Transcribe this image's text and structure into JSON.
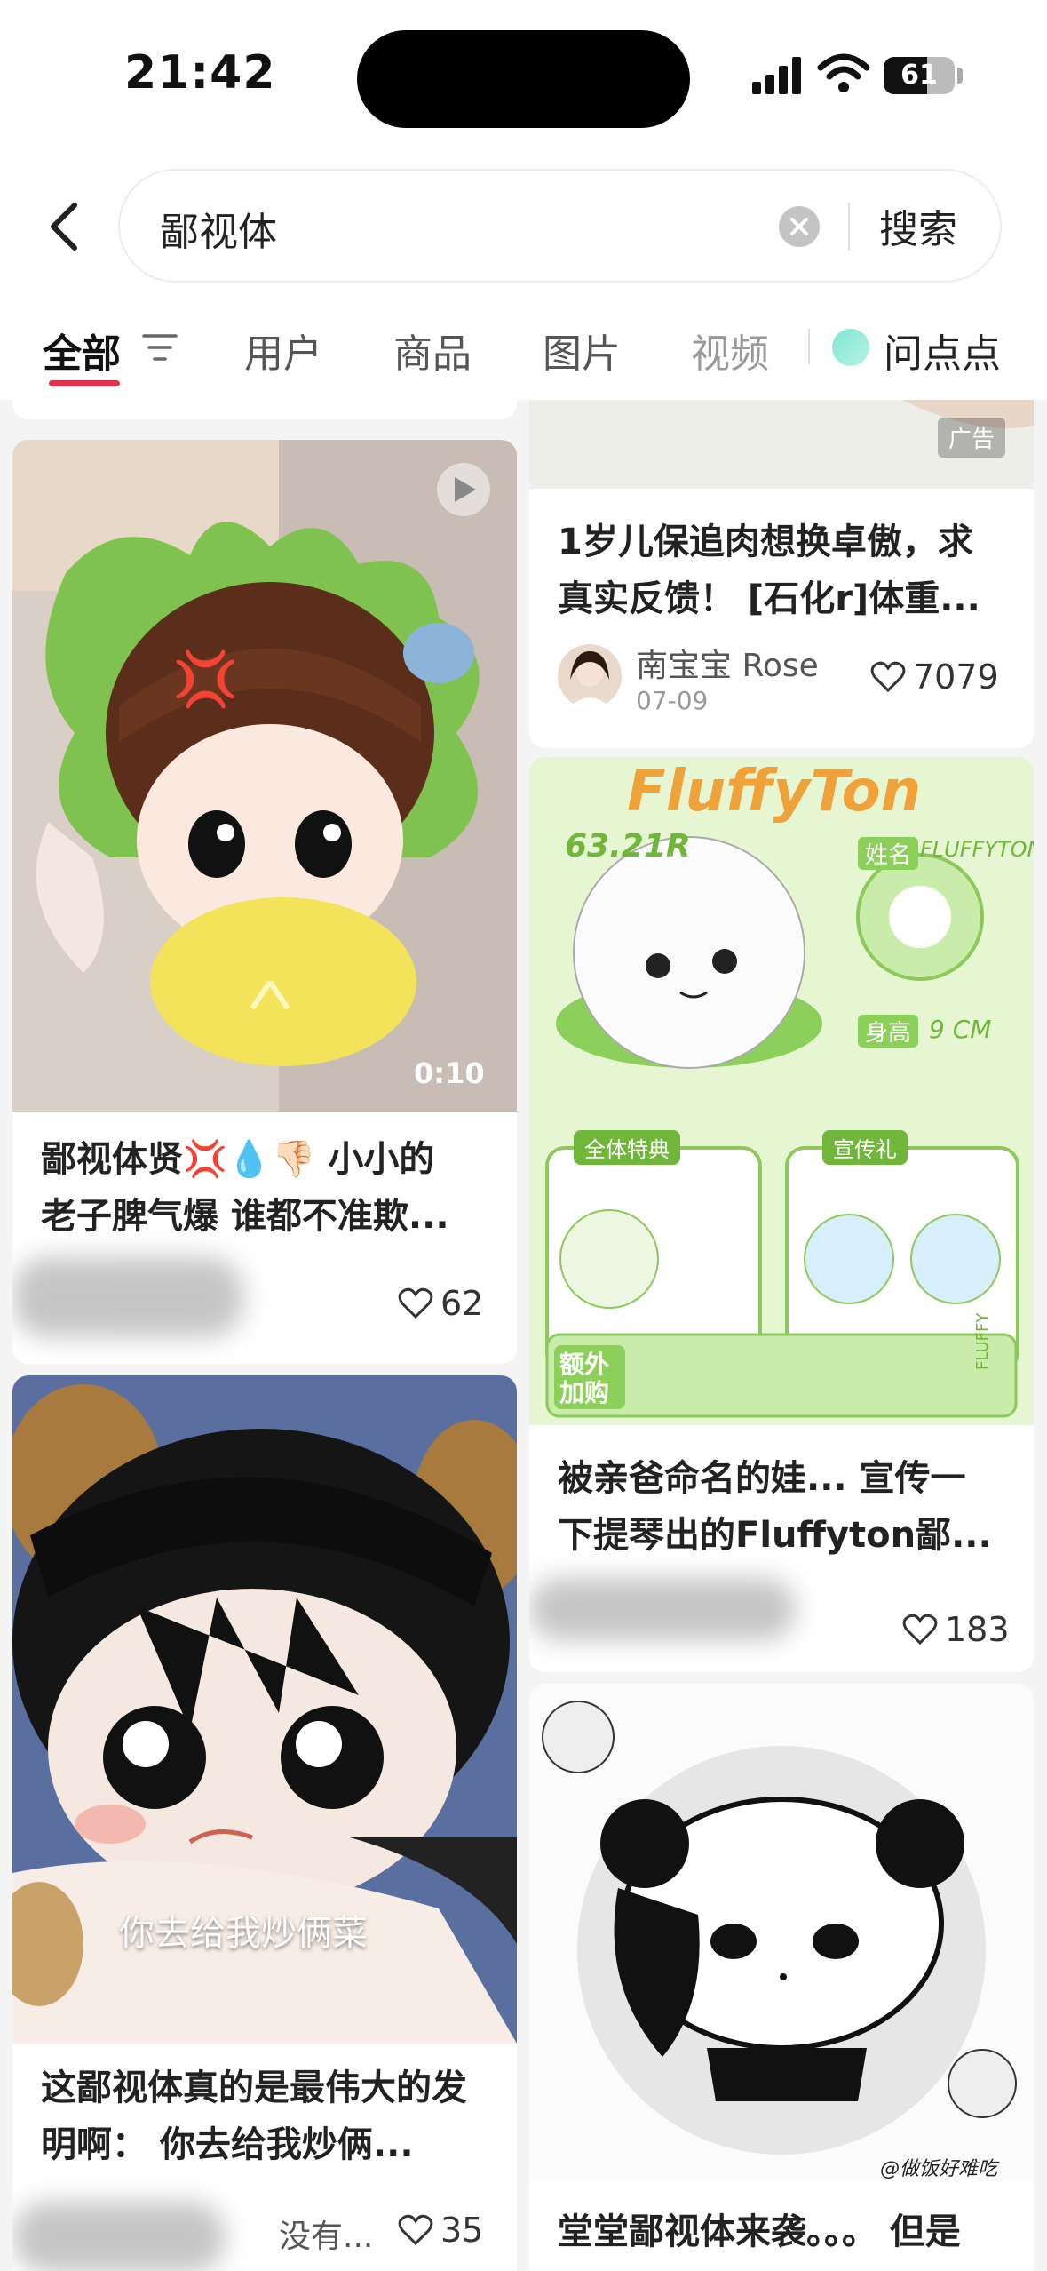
{
  "status_bar": {
    "time": "21:42",
    "battery": "61",
    "battery_level": 0.61
  },
  "search": {
    "query": "鄙视体",
    "button": "搜索"
  },
  "tabs": [
    {
      "label": "全部"
    },
    {
      "label": "用户"
    },
    {
      "label": "商品"
    },
    {
      "label": "图片"
    },
    {
      "label": "视频"
    },
    {
      "label": "问点点"
    }
  ],
  "cards": {
    "left1": {
      "title_line1": "鄙视体贤💢💧👎🏻 小小的",
      "title_line2": "老子脾气爆 谁都不准欺...",
      "likes": "62",
      "duration": "0:10"
    },
    "left2": {
      "title_line1": "这鄙视体真的是最伟大的发",
      "title_line2": "明啊： 你去给我炒俩...",
      "likes": "35",
      "overlay_text": "你去给我炒俩菜",
      "trailing_text": "没有..."
    },
    "right1": {
      "ad_label": "广告",
      "title_line1": "1岁儿保追肉想换卓傲，求",
      "title_line2": "真实反馈！ [石化r]体重...",
      "author": "南宝宝 Rose",
      "date": "07-09",
      "likes": "7079"
    },
    "right2": {
      "poster_title": "FluffyTon",
      "poster_price": "63.21R",
      "poster_name_label": "姓名",
      "poster_name": "FLUFFYTON",
      "poster_height_label": "身高",
      "poster_height": "9 CM",
      "poster_section1": "全体特典",
      "poster_section2": "宣传礼",
      "poster_extra": "额外加购",
      "poster_side": "FLUFFY",
      "title_line1": "被亲爸命名的娃... 宣传一",
      "title_line2": "下提琴出的Fluffyton鄙...",
      "likes": "183"
    },
    "right3": {
      "title_line1": "堂堂鄙视体来袭。。。 但是",
      "watermark": "@做饭好难吃"
    }
  },
  "colors": {
    "accent": "#e0314d",
    "poster_green": "#9fd96a",
    "poster_orange": "#f0a23a"
  }
}
